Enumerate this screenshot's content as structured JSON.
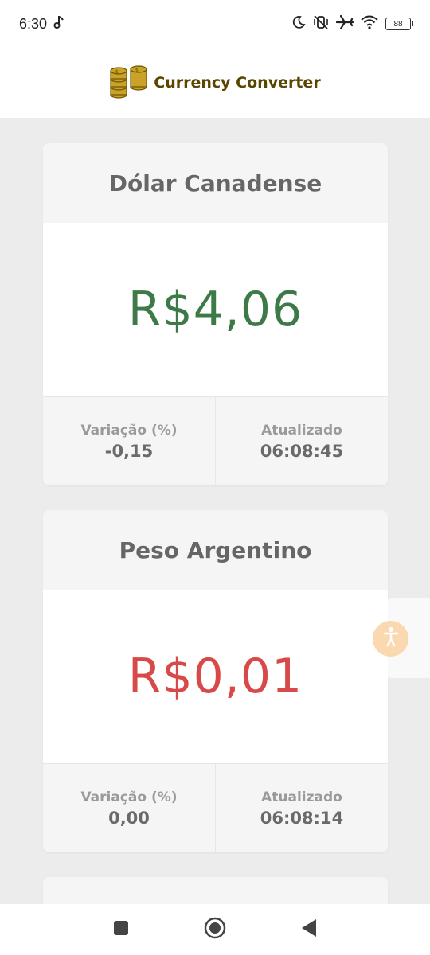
{
  "status_bar": {
    "time": "6:30",
    "battery": "88"
  },
  "header": {
    "title": "Currency Converter",
    "icon": "coins-icon"
  },
  "cards": [
    {
      "name": "Dólar Canadense",
      "value": "R$4,06",
      "value_color": "#3e7a48",
      "variation_label": "Variação (%)",
      "variation_value": "-0,15",
      "updated_label": "Atualizado",
      "updated_value": "06:08:45"
    },
    {
      "name": "Peso Argentino",
      "value": "R$0,01",
      "value_color": "#d84a4a",
      "variation_label": "Variação (%)",
      "variation_value": "0,00",
      "updated_label": "Atualizado",
      "updated_value": "06:08:14"
    }
  ],
  "accessibility_button": {
    "icon": "accessibility-icon",
    "color": "#fbd9b0"
  },
  "nav": {
    "recent": "square-icon",
    "home": "circle-icon",
    "back": "triangle-back-icon"
  }
}
